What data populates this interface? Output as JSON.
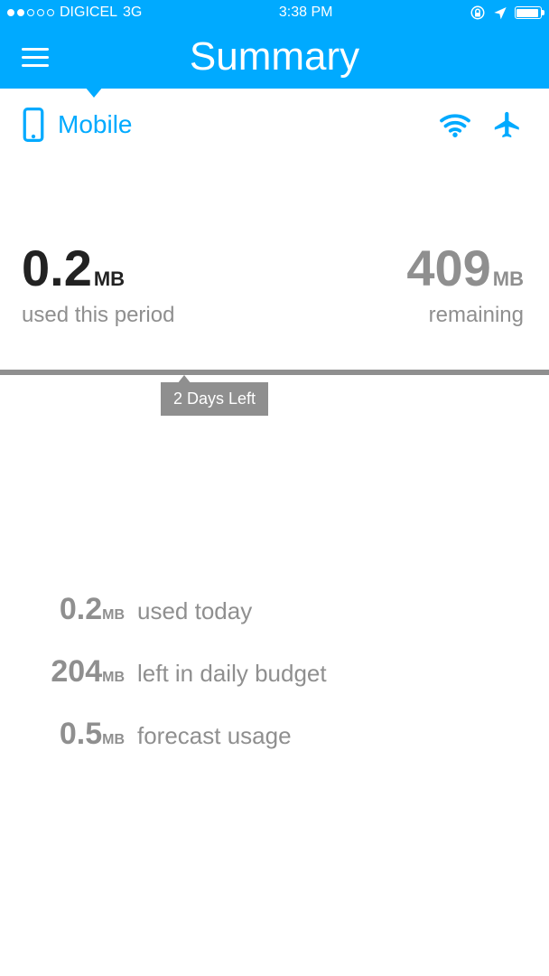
{
  "status": {
    "carrier": "DIGICEL",
    "network": "3G",
    "time": "3:38 PM"
  },
  "header": {
    "title": "Summary"
  },
  "tabs": {
    "mobile": "Mobile"
  },
  "usage": {
    "used_value": "0.2",
    "used_unit": "MB",
    "used_label": "used this period",
    "remaining_value": "409",
    "remaining_unit": "MB",
    "remaining_label": "remaining"
  },
  "badge": "2 Days Left",
  "stats": {
    "today_value": "0.2",
    "today_unit": "MB",
    "today_label": "used today",
    "budget_value": "204",
    "budget_unit": "MB",
    "budget_label": "left in daily budget",
    "forecast_value": "0.5",
    "forecast_unit": "MB",
    "forecast_label": "forecast usage"
  }
}
